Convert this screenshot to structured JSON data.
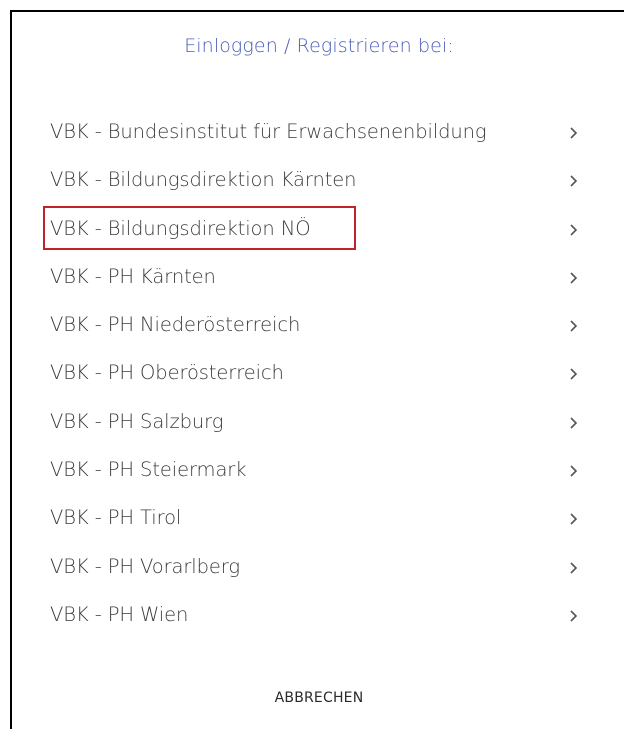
{
  "dialog": {
    "title": "Einloggen / Registrieren bei:",
    "cancel_label": "ABBRECHEN",
    "title_color": "#4a5bb8",
    "highlight_color": "#c0232b"
  },
  "providers": [
    {
      "label": "VBK - Bundesinstitut für Erwachsenenbildung",
      "chevron": "chevron-right-icon"
    },
    {
      "label": "VBK - Bildungsdirektion Kärnten",
      "chevron": "chevron-right-icon"
    },
    {
      "label": "VBK - Bildungsdirektion NÖ",
      "chevron": "chevron-right-icon",
      "highlighted": true
    },
    {
      "label": "VBK - PH Kärnten",
      "chevron": "chevron-right-icon"
    },
    {
      "label": "VBK - PH Niederösterreich",
      "chevron": "chevron-right-icon"
    },
    {
      "label": "VBK - PH Oberösterreich",
      "chevron": "chevron-right-icon"
    },
    {
      "label": "VBK - PH Salzburg",
      "chevron": "chevron-right-icon"
    },
    {
      "label": "VBK - PH Steiermark",
      "chevron": "chevron-right-icon"
    },
    {
      "label": "VBK - PH Tirol",
      "chevron": "chevron-right-icon"
    },
    {
      "label": "VBK - PH Vorarlberg",
      "chevron": "chevron-right-icon"
    },
    {
      "label": "VBK - PH Wien",
      "chevron": "chevron-right-icon"
    }
  ]
}
